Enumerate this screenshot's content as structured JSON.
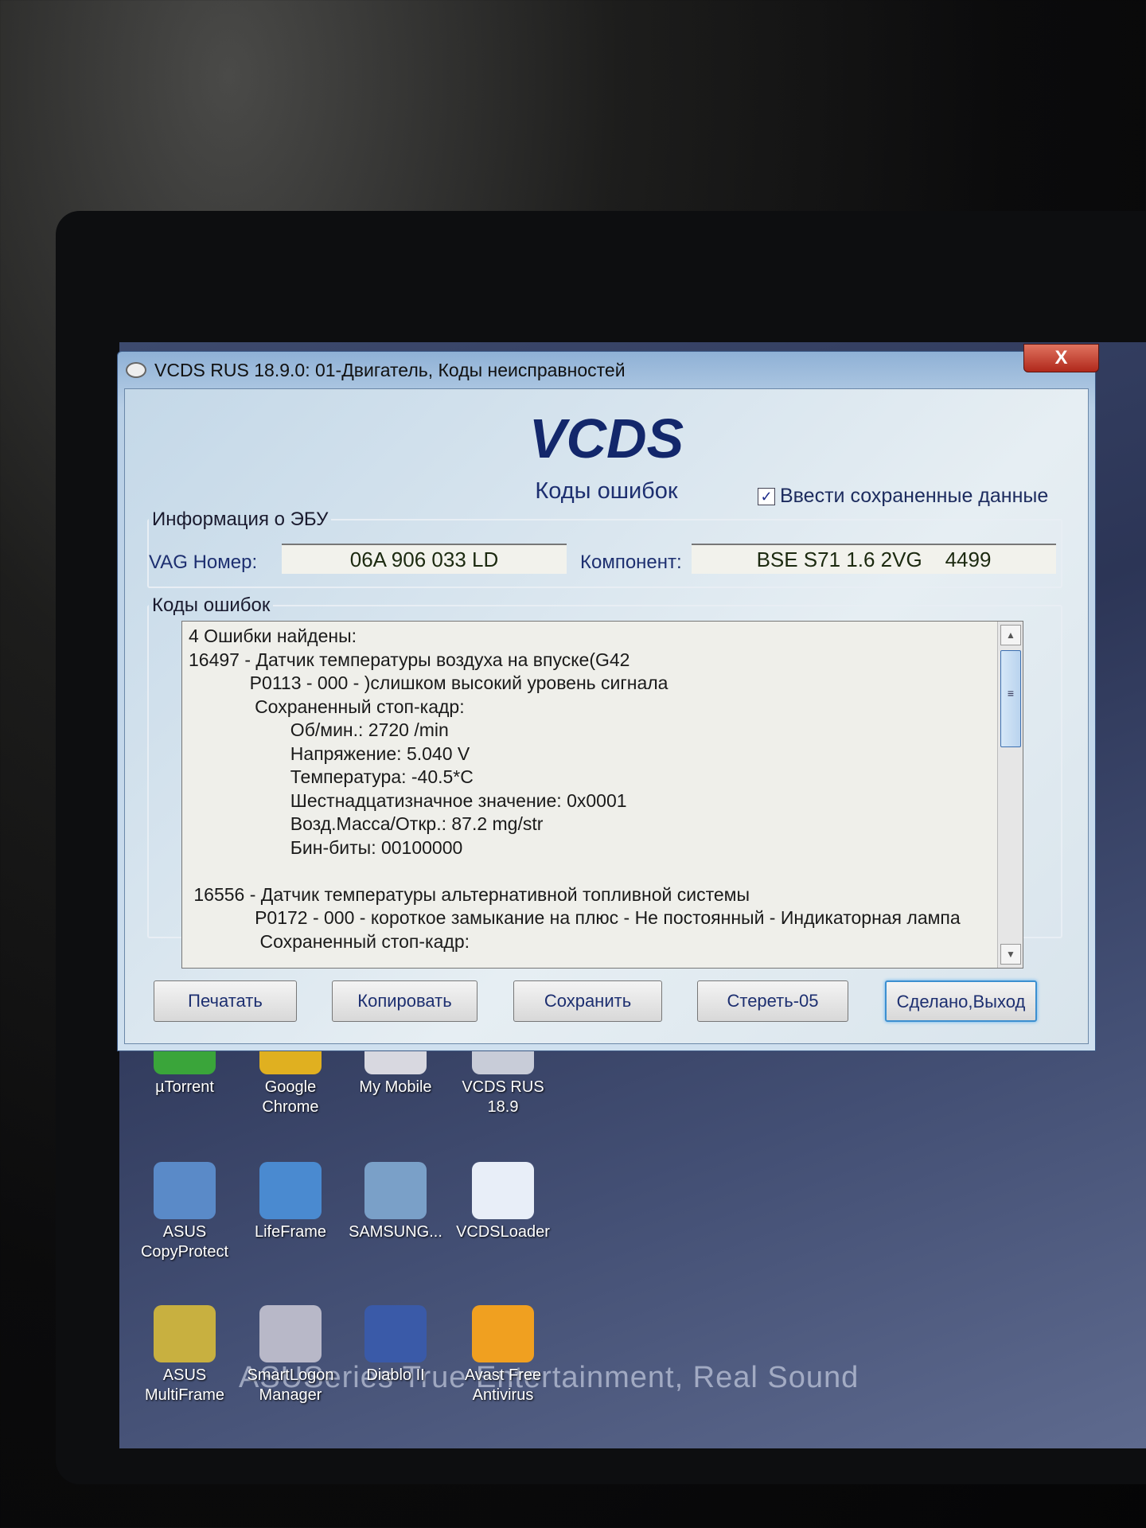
{
  "window": {
    "title": "VCDS RUS 18.9.0: 01-Двигатель,  Коды неисправностей",
    "close_label": "X"
  },
  "header": {
    "logo": "VCDS",
    "subtitle": "Коды ошибок",
    "checkbox_label": "Ввести сохраненные данные",
    "checkbox_checked": true,
    "check_mark": "✓"
  },
  "ecu": {
    "legend": "Информация о ЭБУ",
    "vag_label": "VAG Номер:",
    "vag_value": "06A 906 033 LD",
    "component_label": "Компонент:",
    "component_value": "BSE S71 1.6 2VG    4499"
  },
  "faults": {
    "legend": "Коды ошибок",
    "lines": [
      "4 Ошибки найдены:",
      "16497 - Датчик температуры воздуха на впуске(G42",
      "            P0113 - 000 - )слишком высокий уровень сигнала",
      "             Сохраненный стоп-кадр:",
      "                    Об/мин.: 2720 /min",
      "                    Напряжение: 5.040 V",
      "                    Температура: -40.5*C",
      "                    Шестнадцатизначное значение: 0x0001",
      "                    Возд.Масса/Откр.: 87.2 mg/str",
      "                    Бин-биты: 00100000",
      "",
      " 16556 - Датчик температуры альтернативной топливной системы",
      "             P0172 - 000 - короткое замыкание на плюс - Не постоянный - Индикаторная лампа",
      "              Сохраненный стоп-кадр:"
    ]
  },
  "buttons": [
    "Печатать",
    "Копировать",
    "Сохранить",
    "Стереть-05",
    "Сделано,Выход"
  ],
  "desktop": {
    "icons": [
      {
        "label": "µTorrent",
        "color": "#3aa53a"
      },
      {
        "label": "Google Chrome",
        "color": "#e0b020"
      },
      {
        "label": "My Mobile",
        "color": "#d8d8e0"
      },
      {
        "label": "VCDS RUS 18.9",
        "color": "#c8ccd8"
      },
      {
        "label": "ASUS CopyProtect",
        "color": "#5a8ac8"
      },
      {
        "label": "LifeFrame",
        "color": "#4a8ad0"
      },
      {
        "label": "SAMSUNG...",
        "color": "#7aa0c8"
      },
      {
        "label": "VCDSLoader",
        "color": "#e8eef8"
      },
      {
        "label": "ASUS MultiFrame",
        "color": "#c8b040"
      },
      {
        "label": "SmartLogon Manager",
        "color": "#b8b8c8"
      },
      {
        "label": "Diablo II",
        "color": "#3a5aa8"
      },
      {
        "label": "Avast Free Antivirus",
        "color": "#f0a020"
      }
    ]
  },
  "wallpaper_text": "ASUSeries True Entertainment, Real Sound"
}
